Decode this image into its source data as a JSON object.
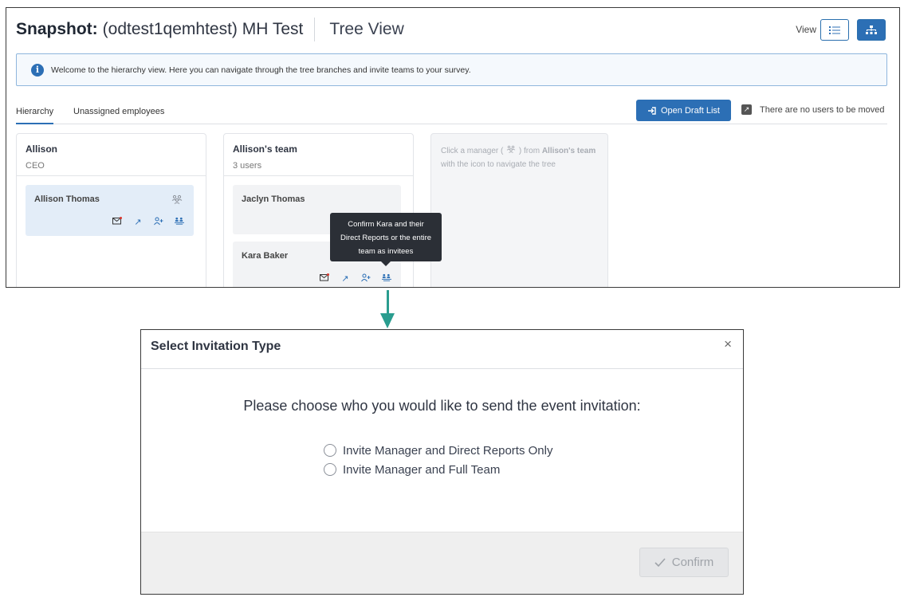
{
  "header": {
    "snapshot_label": "Snapshot:",
    "snapshot_name": "(odtest1qemhtest) MH Test",
    "view_title": "Tree View",
    "view_label": "View"
  },
  "info_banner": {
    "icon": "info-icon",
    "text": "Welcome to the hierarchy view. Here you can navigate through the tree branches and invite teams to your survey."
  },
  "tabs": [
    {
      "label": "Hierarchy",
      "active": true
    },
    {
      "label": "Unassigned employees",
      "active": false
    }
  ],
  "toolbar": {
    "open_draft_label": "Open Draft List",
    "move_note": "There are no users to be moved"
  },
  "columns": [
    {
      "title": "Allison",
      "subtitle": "CEO",
      "cards": [
        {
          "name": "Allison Thomas"
        }
      ]
    },
    {
      "title": "Allison's team",
      "subtitle": "3 users",
      "cards": [
        {
          "name": "Jaclyn Thomas"
        },
        {
          "name": "Kara Baker"
        }
      ]
    },
    {
      "hint_prefix": "Click a manager (",
      "hint_mid": ") from",
      "hint_bold": "Allison's team",
      "hint_suffix": "with the icon to navigate the tree"
    }
  ],
  "tooltip": {
    "line1": "Confirm Kara and their",
    "line2": "Direct Reports or the entire",
    "line3": "team as invitees"
  },
  "modal": {
    "title": "Select Invitation Type",
    "close": "×",
    "question": "Please choose who you would like to send the event invitation:",
    "options": [
      {
        "label": "Invite Manager and Direct Reports Only",
        "selected": false
      },
      {
        "label": "Invite Manager and Full Team",
        "selected": false
      }
    ],
    "confirm_label": "Confirm",
    "confirm_icon": "check-icon"
  },
  "colors": {
    "accent": "#2c6fb5",
    "arrow": "#2a9d8f",
    "tooltip_bg": "#2b2f36"
  }
}
